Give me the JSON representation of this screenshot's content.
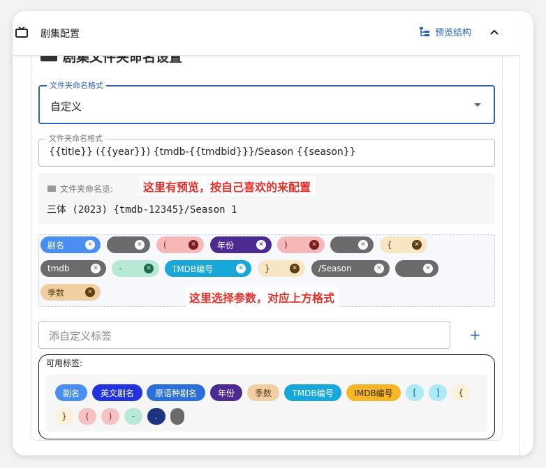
{
  "header": {
    "title": "剧集配置",
    "preview_label": "预览结构"
  },
  "section": {
    "title": "剧集文件夹命名设置"
  },
  "format_select": {
    "label": "文件夹命名格式",
    "value": "自定义"
  },
  "format_input": {
    "label": "文件夹命名格式",
    "value": "{{title}} ({{year}}) {tmdb-{{tmdbid}}}/Season {{season}}"
  },
  "preview": {
    "label": "文件夹命名览:",
    "value": "三体 (2023) {tmdb-12345}/Season 1"
  },
  "annotations": {
    "preview_note": "这里有预览，按自己喜欢的来配置",
    "params_note": "这里选择参数，对应上方格式"
  },
  "selected_chips": [
    {
      "label": "剧名",
      "bg": "#4a8ef2",
      "fg": "#ffffff"
    },
    {
      "label": "",
      "bg": "#6b6b6b",
      "fg": "#ffffff"
    },
    {
      "label": "(",
      "bg": "#f5b7b7",
      "fg": "#7a1d1d"
    },
    {
      "label": "年份",
      "bg": "#4b2a91",
      "fg": "#ffffff"
    },
    {
      "label": ")",
      "bg": "#f5b7b7",
      "fg": "#7a1d1d"
    },
    {
      "label": "",
      "bg": "#6b6b6b",
      "fg": "#ffffff"
    },
    {
      "label": "{",
      "bg": "#f7e6c4",
      "fg": "#5c3d12"
    },
    {
      "label": "tmdb",
      "bg": "#6b6b6b",
      "fg": "#ffffff"
    },
    {
      "label": "-",
      "bg": "#b7e9d6",
      "fg": "#1d6b4a"
    },
    {
      "label": "TMDB编号",
      "bg": "#17a7d8",
      "fg": "#ffffff"
    },
    {
      "label": "}",
      "bg": "#f7e6c4",
      "fg": "#5c3d12"
    },
    {
      "label": "/Season",
      "bg": "#6b6b6b",
      "fg": "#ffffff"
    },
    {
      "label": "",
      "bg": "#6b6b6b",
      "fg": "#ffffff"
    },
    {
      "label": "季数",
      "bg": "#f2cfa3",
      "fg": "#5c3d12"
    }
  ],
  "add_tag": {
    "placeholder": "添自定义标签",
    "add_label": "+"
  },
  "available": {
    "label": "可用标签:",
    "tags": [
      {
        "label": "剧名",
        "bg": "#4a8ef2",
        "fg": "#ffffff"
      },
      {
        "label": "英文剧名",
        "bg": "#2233dd",
        "fg": "#ffffff"
      },
      {
        "label": "原语种剧名",
        "bg": "#2a6fd8",
        "fg": "#ffffff"
      },
      {
        "label": "年份",
        "bg": "#4b2a91",
        "fg": "#ffffff"
      },
      {
        "label": "季数",
        "bg": "#f2cfa3",
        "fg": "#5c3d12"
      },
      {
        "label": "TMDB编号",
        "bg": "#17a7d8",
        "fg": "#ffffff"
      },
      {
        "label": "IMDB编号",
        "bg": "#f5b62a",
        "fg": "#3b2a05"
      },
      {
        "label": "[",
        "bg": "#aeeaf5",
        "fg": "#135b6b"
      },
      {
        "label": "]",
        "bg": "#aeeaf5",
        "fg": "#135b6b"
      },
      {
        "label": "{",
        "bg": "#fbf1d8",
        "fg": "#5c3d12"
      },
      {
        "label": "}",
        "bg": "#fbf1d8",
        "fg": "#5c3d12"
      },
      {
        "label": "(",
        "bg": "#f5c3c3",
        "fg": "#7a1d1d"
      },
      {
        "label": ")",
        "bg": "#f5c3c3",
        "fg": "#7a1d1d"
      },
      {
        "label": "-",
        "bg": "#b7e9d6",
        "fg": "#1d6b4a"
      },
      {
        "label": ".",
        "bg": "#1f3480",
        "fg": "#ffffff"
      },
      {
        "label": "",
        "bg": "#6b6b6b",
        "fg": "#ffffff"
      }
    ]
  }
}
